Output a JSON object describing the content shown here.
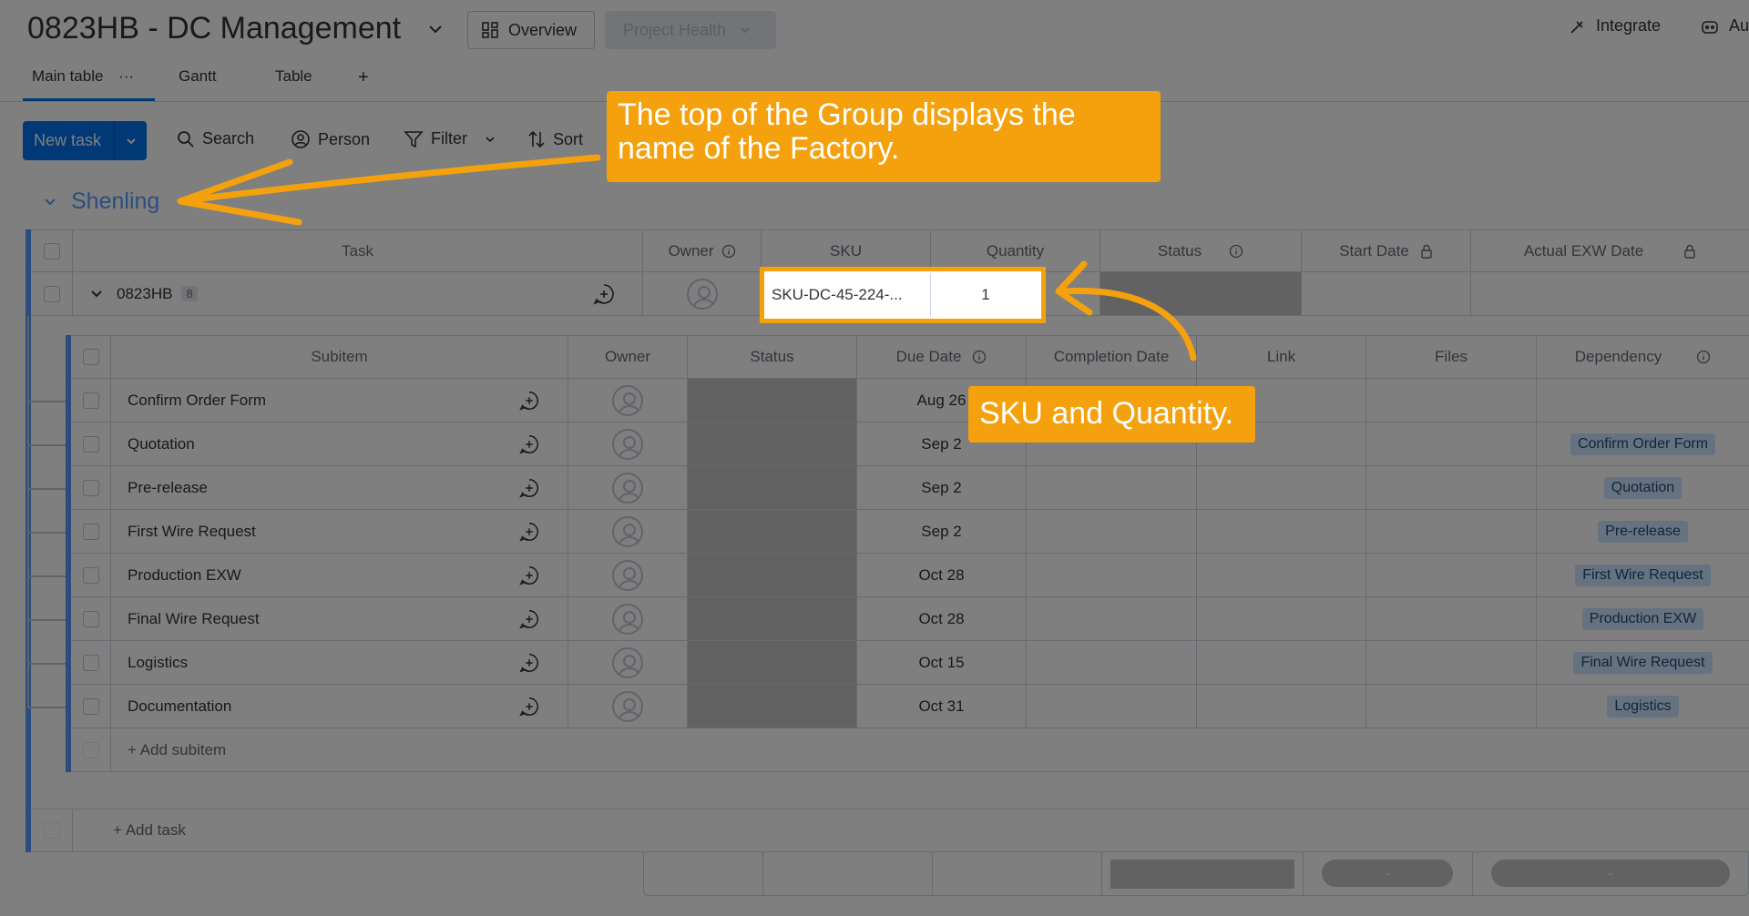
{
  "header": {
    "title": "0823HB - DC Management",
    "overview_label": "Overview",
    "project_health_label": "Project Health",
    "integrate_label": "Integrate",
    "automate_label": "Au"
  },
  "tabs": [
    {
      "label": "Main table",
      "more": "···"
    },
    {
      "label": "Gantt"
    },
    {
      "label": "Table"
    },
    {
      "label": "+"
    }
  ],
  "toolbar": {
    "new_task_label": "New task",
    "search_label": "Search",
    "person_label": "Person",
    "filter_label": "Filter",
    "sort_label": "Sort"
  },
  "group": {
    "name": "Shenling",
    "columns": [
      "Task",
      "Owner",
      "SKU",
      "Quantity",
      "Status",
      "Start Date",
      "Actual EXW Date"
    ],
    "task": {
      "name": "0823HB",
      "subitem_count": "8",
      "sku": "SKU-DC-45-224-...",
      "quantity": "1"
    },
    "add_task_label": "+ Add task",
    "summary_dash_1": "-",
    "summary_dash_2": "-"
  },
  "subitems": {
    "columns": [
      "Subitem",
      "Owner",
      "Status",
      "Due Date",
      "Completion Date",
      "Link",
      "Files",
      "Dependency"
    ],
    "rows": [
      {
        "name": "Confirm Order Form",
        "due": "Aug 26",
        "dependency": ""
      },
      {
        "name": "Quotation",
        "due": "Sep 2",
        "dependency": "Confirm Order Form"
      },
      {
        "name": "Pre-release",
        "due": "Sep 2",
        "dependency": "Quotation"
      },
      {
        "name": "First Wire Request",
        "due": "Sep 2",
        "dependency": "Pre-release"
      },
      {
        "name": "Production EXW",
        "due": "Oct 28",
        "dependency": "First Wire Request"
      },
      {
        "name": "Final Wire Request",
        "due": "Oct 28",
        "dependency": "Production EXW"
      },
      {
        "name": "Logistics",
        "due": "Oct 15",
        "dependency": "Final Wire Request"
      },
      {
        "name": "Documentation",
        "due": "Oct 31",
        "dependency": "Logistics"
      }
    ],
    "add_subitem_label": "+ Add subitem"
  },
  "annotations": {
    "group_callout": "The top of the Group displays the name of the Factory.",
    "sku_callout": "SKU and Quantity."
  },
  "colors": {
    "accent": "#0073ea",
    "group": "#579bfc",
    "callout": "#f4a10d"
  }
}
